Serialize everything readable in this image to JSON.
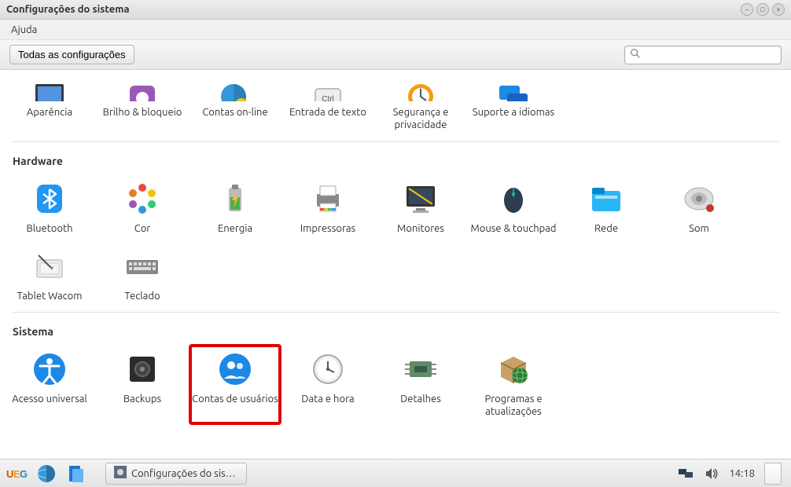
{
  "window": {
    "title": "Configurações do sistema",
    "controls": {
      "min": "−",
      "max": "□",
      "close": "×"
    }
  },
  "menubar": {
    "help": "Ajuda"
  },
  "toolbar": {
    "all_settings": "Todas as configurações",
    "search_placeholder": ""
  },
  "sections": {
    "personal": {
      "items": {
        "appearance": "Aparência",
        "brightness": "Brilho & bloqueio",
        "online_accounts": "Contas on-line",
        "text_entry": "Entrada de texto",
        "security": "Segurança e privacidade",
        "language": "Suporte a idiomas"
      }
    },
    "hardware": {
      "title": "Hardware",
      "items": {
        "bluetooth": "Bluetooth",
        "color": "Cor",
        "energy": "Energia",
        "printers": "Impressoras",
        "monitors": "Monitores",
        "mouse": "Mouse & touchpad",
        "network": "Rede",
        "sound": "Som",
        "wacom": "Tablet Wacom",
        "keyboard": "Teclado"
      }
    },
    "system": {
      "title": "Sistema",
      "items": {
        "universal": "Acesso universal",
        "backups": "Backups",
        "users": "Contas de usuários",
        "datetime": "Data e hora",
        "details": "Detalhes",
        "updates": "Programas e atualizações"
      }
    }
  },
  "panel": {
    "task_title": "Configurações do sis…",
    "clock": "14:18"
  }
}
